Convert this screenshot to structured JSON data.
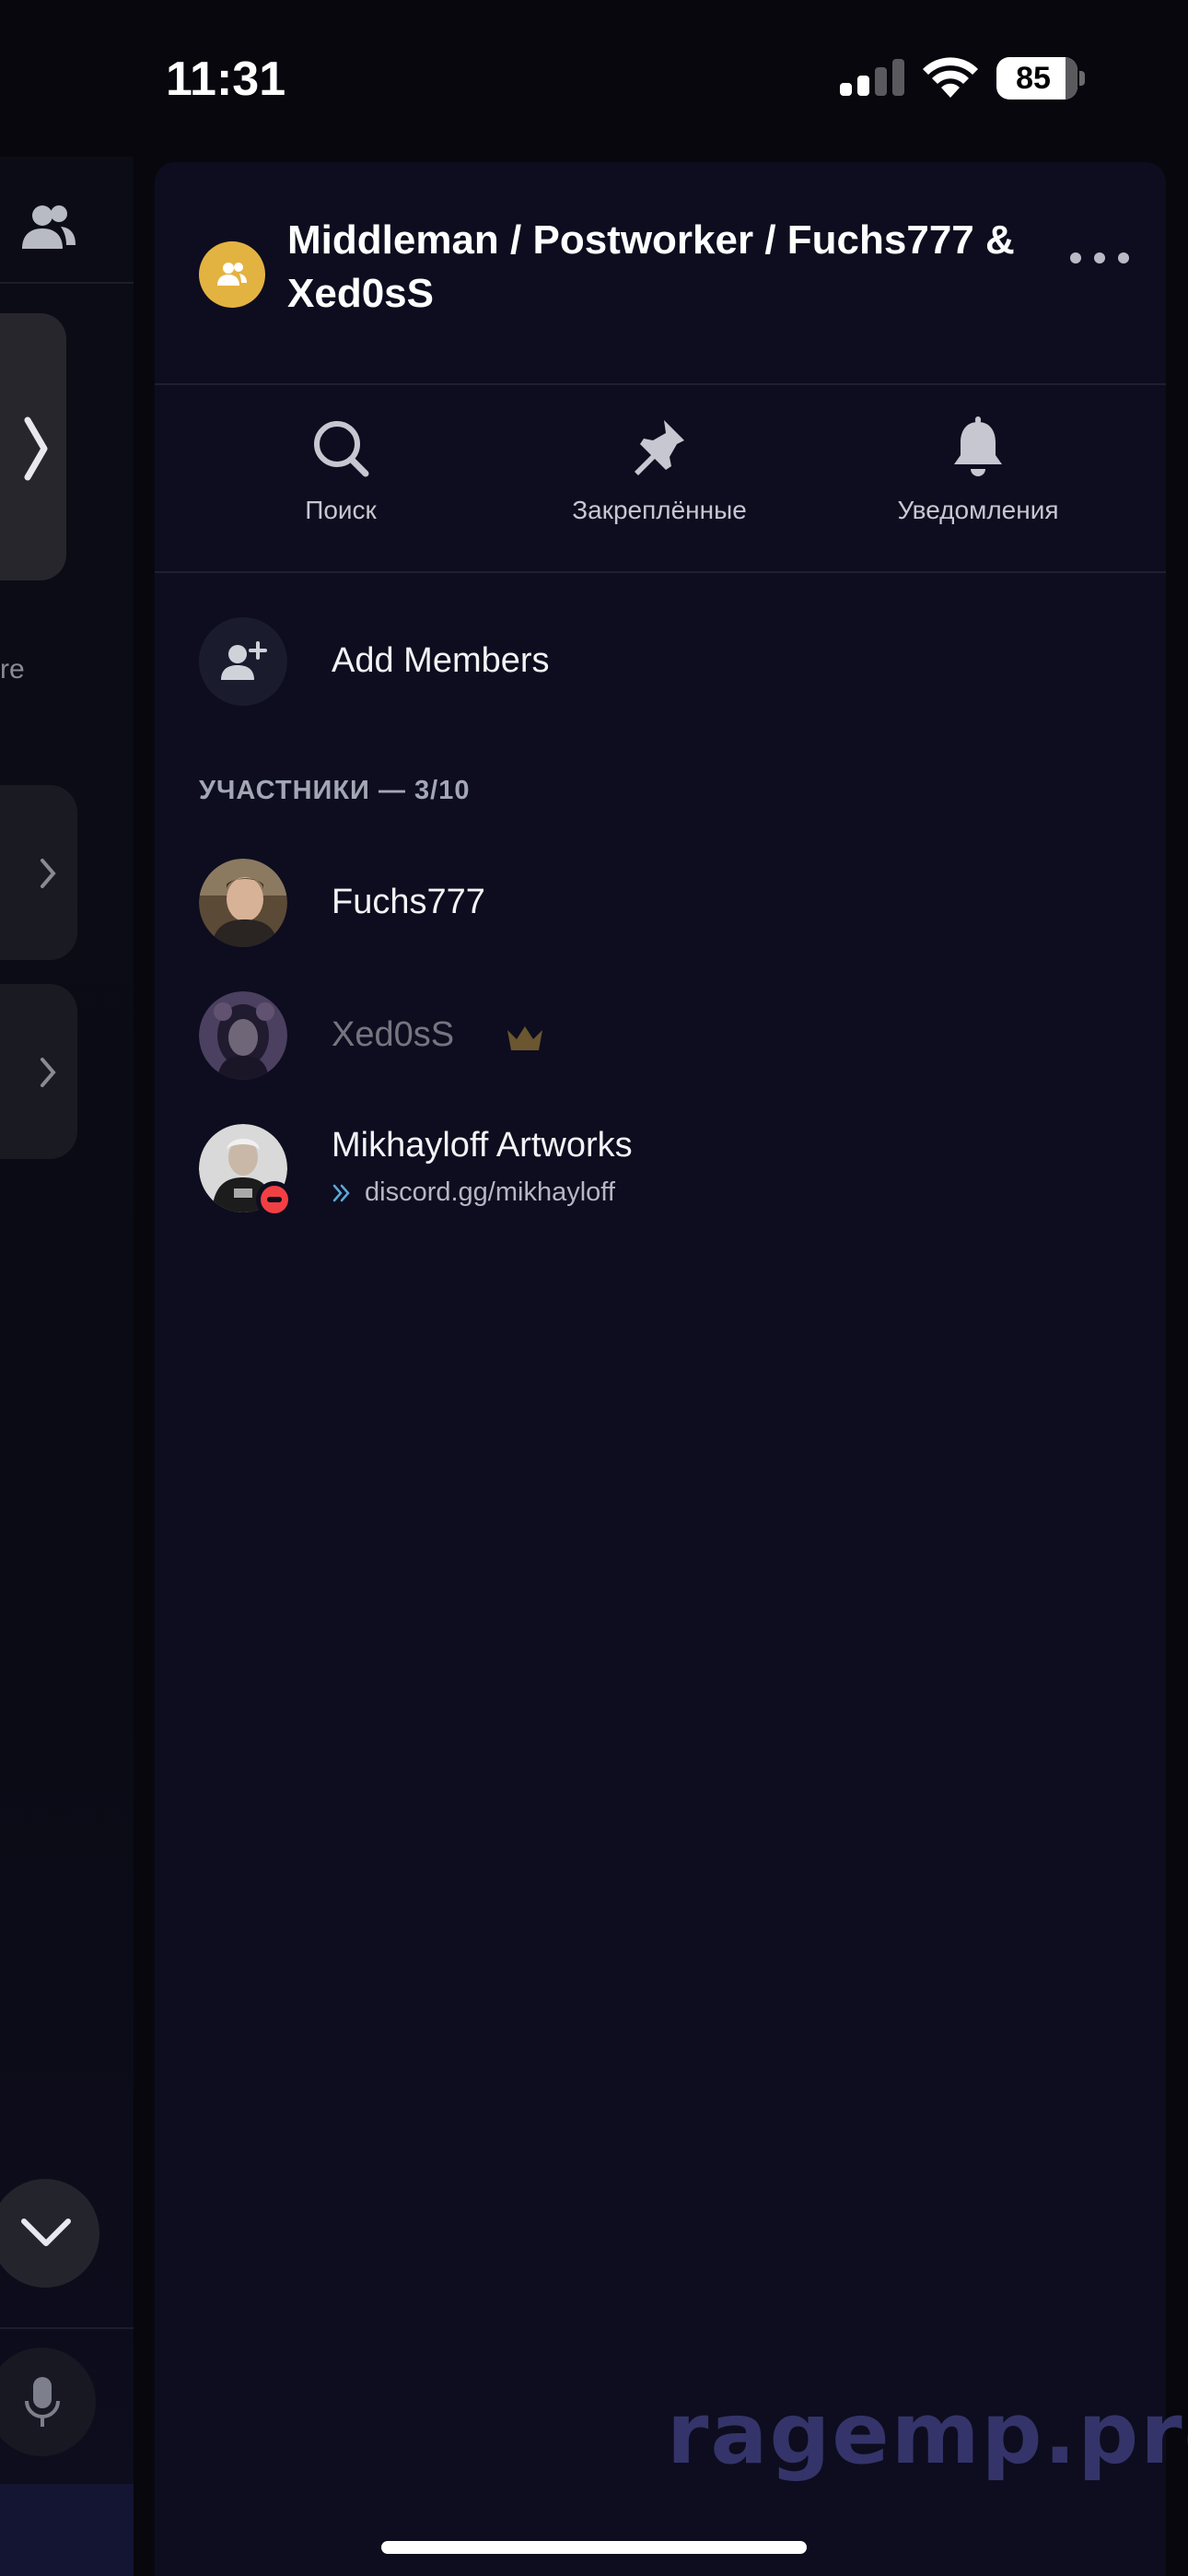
{
  "status_bar": {
    "time": "11:31",
    "battery": "85"
  },
  "left_pane": {
    "partial_text": "re"
  },
  "panel": {
    "title": "Middleman / Postworker / Fuchs777 & Xed0sS",
    "actions": [
      {
        "label": "Поиск",
        "icon": "search-icon"
      },
      {
        "label": "Закреплённые",
        "icon": "pin-icon"
      },
      {
        "label": "Уведомления",
        "icon": "bell-icon"
      }
    ],
    "add_members_label": "Add Members",
    "members_header": "УЧАСТНИКИ — 3/10",
    "members": [
      {
        "name": "Fuchs777"
      },
      {
        "name": "Xed0sS",
        "owner": true
      },
      {
        "name": "Mikhayloff Artworks",
        "status": "discord.gg/mikhayloff",
        "presence": "do-not-disturb"
      }
    ]
  },
  "watermark": "ragemp.pro",
  "colors": {
    "accent_group": "#e3b341",
    "background": "#0d0d1f",
    "dnd": "#f23f43"
  }
}
